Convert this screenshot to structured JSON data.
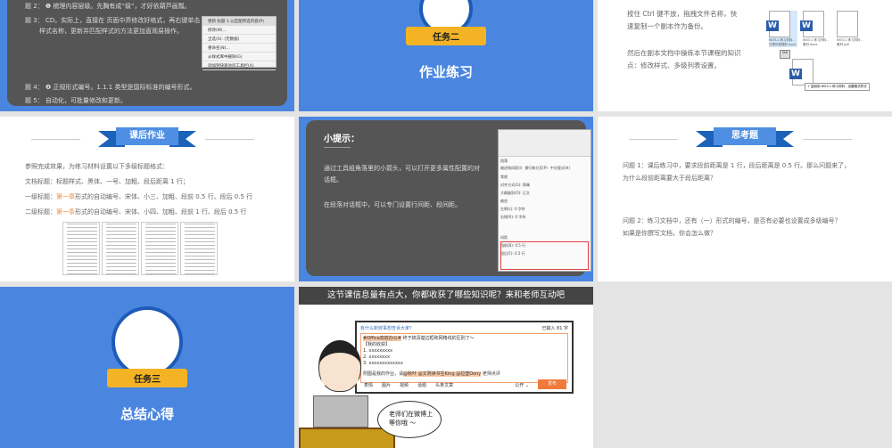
{
  "slide1": {
    "lines": [
      "题 2： ❶ 梳理内容层级。先胸有成“级”，才好依葫芦画瓢。",
      "题 3： CD。实际上，直接在 页面中弄修改好格式，再右键单击",
      "样式名称，更新并匹配样式的方法更加直观易操作。",
      "题 4： ❹ 正规形式编号。1.1.1 类型是国际标准的编号形式。",
      "题 5： 自动化，可批量修改和更新。"
    ],
    "menu": [
      "更新 标题 1 以匹配所选内容(P)",
      "修改(M)...",
      "全选(S): (无数据)",
      "重命名(N)...",
      "从样式库中删除(G)",
      "添加到快速访问工具栏(A)"
    ]
  },
  "slide2": {
    "banner": "任务二",
    "title": "作业练习"
  },
  "slide3": {
    "p1": [
      "按住 Ctrl 键不放，拖拽文件名称，快",
      "速复制一个副本作为备份。"
    ],
    "p2": [
      "然后在副本文档中操练本节课程的知识",
      "点：修改样式、多级列表设置。"
    ],
    "files": [
      "W03-1 练习材料 - 已帮你梳理好.docx",
      "W03-1 练习材料 - 素材.docx",
      "W03-1 练习材料 - 素材.pdf"
    ],
    "ctrl": "Ctrl",
    "copy_tip": "+ 复制到 W03-1 练习材料 - 设置格式样式"
  },
  "slide4": {
    "ribbon": "课后作业",
    "intro": "参照完成效果，为练习材料设置以下多级标题格式：",
    "l1": "文档标题：标题样式、黑体、一号、加粗、段后距离 1 行；",
    "l2a": "一级标题：",
    "l2b": "第一章",
    "l2c": "形式的自动编号、宋体、小三、加粗、段前 0.5 行、段后 0.5 行",
    "l3a": "二级标题：",
    "l3b": "第一条",
    "l3c": "形式的自动编号、宋体、小四、加粗、段前 1 行、段后 0.5 行",
    "accent": "#f08a3c"
  },
  "slide5": {
    "heading": "小提示：",
    "p1": [
      "通过工具组角落里的小箭头，可以打开更多属性配置的对",
      "话框。"
    ],
    "p2": "在段落对话框中，可以专门设置行间距、段间距。",
    "dialog": {
      "title": "段落",
      "tabs": [
        "缩进和间距(I)",
        "换行和分页(P)",
        "中文版式(H)"
      ],
      "sections": [
        "常规",
        "缩进",
        "间距"
      ],
      "rows": [
        "对齐方式(G): 两端",
        "大纲级别(O): 正文",
        "左侧(L): 0 字符",
        "右侧(R): 0 字符",
        "段前(B): 0.5 行",
        "段后(F): 0.5 行"
      ]
    }
  },
  "slide6": {
    "ribbon": "思考题",
    "q1": [
      "问题 1：课后练习中，要求段前距离是 1 行，段后距离是 0.5 行。那么问题来了，",
      "为什么段前距离要大于段后距离？"
    ],
    "q2": [
      "问题 2：练习文档中，还有（一）形式的编号，是否有必要也设置成多级编号？",
      "如果是你撰写文档，你会怎么做？"
    ]
  },
  "slide7": {
    "banner": "任务三",
    "title": "总结心得"
  },
  "slide8": {
    "bar": "这节课信息量有点大，你都收获了哪些知识呢？来和老师互动吧",
    "prompt": "有什么新鲜事想告诉大家？",
    "count": "已输入 81 字",
    "tag": "#Office高效办公#",
    "line1": " 终于搞清楚边框和网格线的区别了～",
    "gain": "【我的收获】",
    "items": [
      "1. xxxxxxxxx",
      "2. xxxxxxxx",
      "3. xxxxxxxxxxxxx"
    ],
    "line5a": "附图是我的作业，请",
    "mentions": "@秋叶 @文则读书生King @拉登Dony",
    "line5b": " 老师点评",
    "tools": [
      "表情",
      "图片",
      "视频",
      "话题",
      "头条文章"
    ],
    "public": "公开 ⌄",
    "send": "发布",
    "bubble": [
      "老师们在微博上",
      "等你哦 ～"
    ]
  }
}
